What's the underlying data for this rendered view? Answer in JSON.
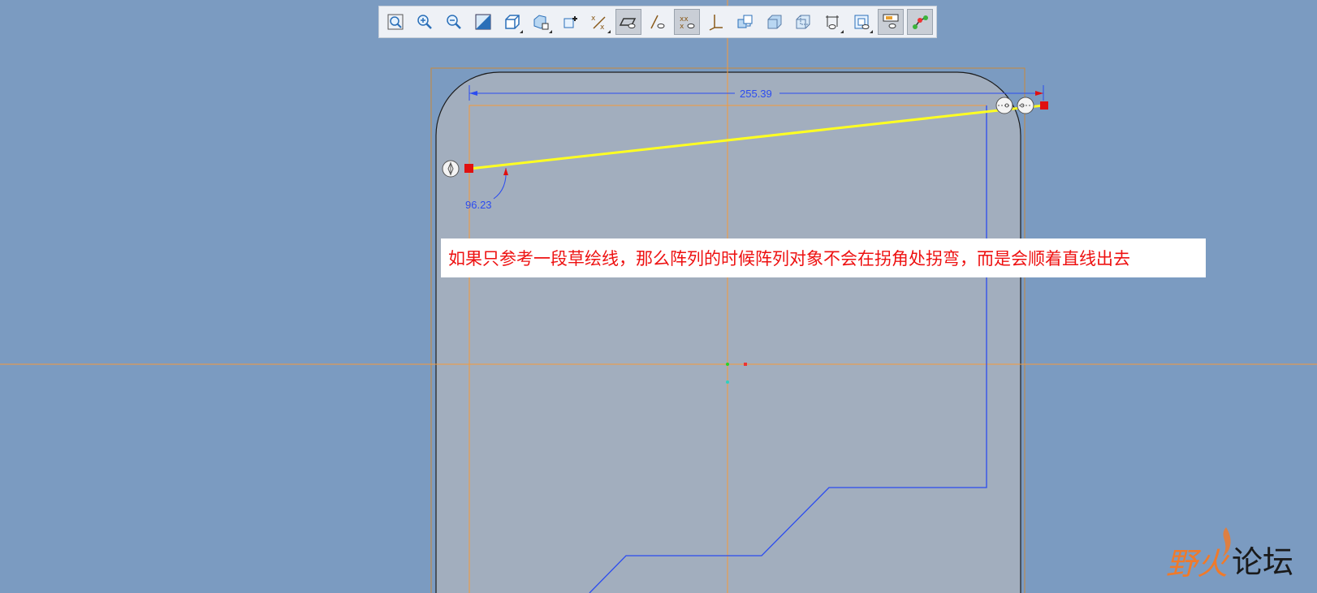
{
  "toolbar": {
    "buttons": [
      {
        "icon": "zoom-fit-icon",
        "active": false
      },
      {
        "icon": "zoom-in-icon",
        "active": false
      },
      {
        "icon": "zoom-out-icon",
        "active": false
      },
      {
        "icon": "repaint-icon",
        "active": false
      },
      {
        "icon": "view-orientation-icon",
        "active": false,
        "menu": true
      },
      {
        "icon": "saved-views-icon",
        "active": false,
        "menu": true
      },
      {
        "icon": "display-style-icon",
        "active": false
      },
      {
        "icon": "datum-display-icon",
        "active": false,
        "menu": true
      },
      {
        "icon": "sketch-view-icon",
        "active": true
      },
      {
        "icon": "show-dimensions-icon",
        "active": false
      },
      {
        "icon": "show-constraints-icon",
        "active": true
      },
      {
        "icon": "show-vertices-icon",
        "active": false
      },
      {
        "icon": "shading-icon",
        "active": false
      },
      {
        "icon": "solid-view-icon",
        "active": false
      },
      {
        "icon": "wireframe-view-icon",
        "active": false
      },
      {
        "icon": "dimension-filter-icon",
        "active": false,
        "menu": true
      },
      {
        "icon": "grid-snap-icon",
        "active": false,
        "menu": true
      },
      {
        "icon": "overlay-display-icon",
        "active": true
      },
      {
        "icon": "connect-points-icon",
        "active": true
      }
    ]
  },
  "sketch": {
    "length_dimension": "255.39",
    "angle_dimension": "96.23"
  },
  "annotation": {
    "text": "如果只参考一段草绘线，那么阵列的时候阵列对象不会在拐角处拐弯，而是会顺着直线出去"
  },
  "watermark": {
    "orange_text": "野火",
    "black_text": "论坛"
  },
  "colors": {
    "background": "#7b9bc1",
    "part_fill": "#a2aebe",
    "sketch_line": "#ffff22",
    "datum": "#f59a3a",
    "dimension": "#2b4cf0",
    "endpoint": "#e01010"
  }
}
